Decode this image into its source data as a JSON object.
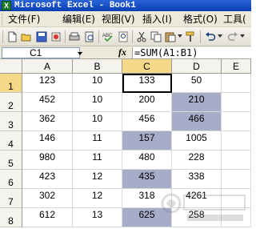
{
  "window": {
    "title": "Microsoft Excel - Book1",
    "icon": "excel-icon"
  },
  "menu": {
    "items": [
      {
        "label": "文件(F)",
        "key": "file"
      },
      {
        "label": "编辑(E)",
        "key": "edit"
      },
      {
        "label": "视图(V)",
        "key": "view"
      },
      {
        "label": "插入(I)",
        "key": "insert"
      },
      {
        "label": "格式(O)",
        "key": "format"
      },
      {
        "label": "工具(",
        "key": "tools"
      }
    ]
  },
  "toolbar": {
    "icons": [
      "new-icon",
      "open-icon",
      "save-icon",
      "permission-icon",
      "print-icon",
      "print-preview-icon",
      "spelling-icon",
      "research-icon",
      "cut-icon",
      "copy-icon",
      "paste-icon",
      "format-painter-icon",
      "undo-icon",
      "redo-icon"
    ]
  },
  "formula_bar": {
    "name_box": "C1",
    "fx_label": "fx",
    "formula": "=SUM(A1:B1)"
  },
  "sheet": {
    "columns": [
      "A",
      "B",
      "C",
      "D",
      "E"
    ],
    "active_column": "C",
    "active_row": 1,
    "rows": [
      {
        "label": "1",
        "cells": [
          "123",
          "10",
          "133",
          "50"
        ]
      },
      {
        "label": "2",
        "cells": [
          "452",
          "10",
          "200",
          "210"
        ]
      },
      {
        "label": "3",
        "cells": [
          "362",
          "10",
          "456",
          "466"
        ]
      },
      {
        "label": "4",
        "cells": [
          "146",
          "11",
          "157",
          "1005"
        ]
      },
      {
        "label": "5",
        "cells": [
          "980",
          "11",
          "480",
          "228"
        ]
      },
      {
        "label": "6",
        "cells": [
          "423",
          "12",
          "435",
          "338"
        ]
      },
      {
        "label": "7",
        "cells": [
          "302",
          "12",
          "318",
          "4261"
        ]
      },
      {
        "label": "8",
        "cells": [
          "612",
          "13",
          "625",
          "258"
        ]
      }
    ],
    "highlighted_cells": [
      "D2",
      "D3",
      "C4",
      "C6",
      "C8"
    ],
    "highlight_color": "#a7acc8",
    "selected_cell": "C1"
  }
}
